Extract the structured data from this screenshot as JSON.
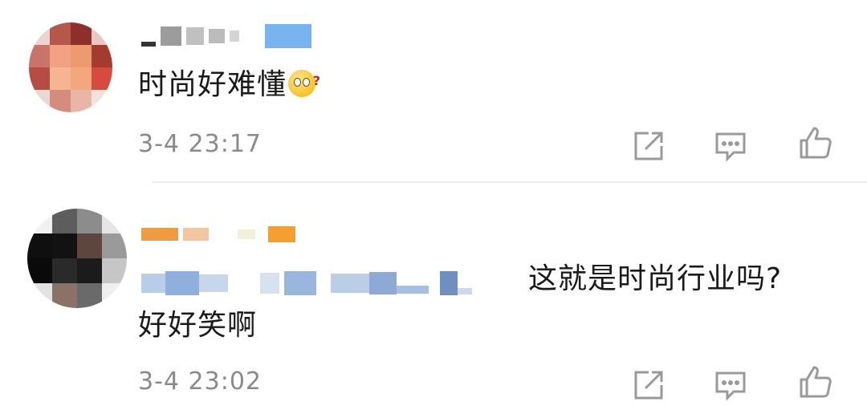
{
  "comments": [
    {
      "text": "时尚好难懂",
      "timestamp": "3-4 23:17",
      "emoji": "thinking-face-emoji"
    },
    {
      "text_suffix": "这就是时尚行业吗?",
      "text_line2": "好好笑啊",
      "timestamp": "3-4 23:02"
    }
  ],
  "actions": {
    "share_icon": "share-icon",
    "comment_icon": "comment-icon",
    "like_icon": "thumbs-up-icon"
  },
  "colors": {
    "timestamp": "#8a8a8a",
    "icon": "#9a9a9a",
    "divider": "#ececec"
  }
}
